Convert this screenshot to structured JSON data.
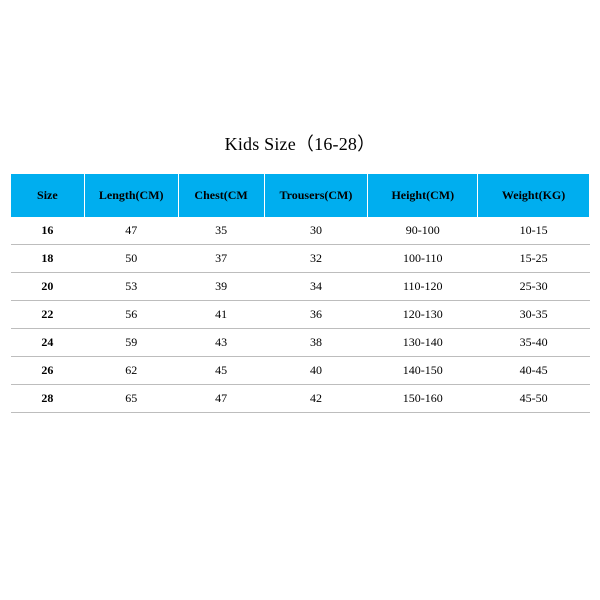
{
  "title": "Kids Size（16-28）",
  "columns": [
    "Size",
    "Length(CM)",
    "Chest(CM",
    "Trousers(CM)",
    "Height(CM)",
    "Weight(KG)"
  ],
  "rows": [
    {
      "size": "16",
      "length": "47",
      "chest": "35",
      "trousers": "30",
      "height": "90-100",
      "weight": "10-15"
    },
    {
      "size": "18",
      "length": "50",
      "chest": "37",
      "trousers": "32",
      "height": "100-110",
      "weight": "15-25"
    },
    {
      "size": "20",
      "length": "53",
      "chest": "39",
      "trousers": "34",
      "height": "110-120",
      "weight": "25-30"
    },
    {
      "size": "22",
      "length": "56",
      "chest": "41",
      "trousers": "36",
      "height": "120-130",
      "weight": "30-35"
    },
    {
      "size": "24",
      "length": "59",
      "chest": "43",
      "trousers": "38",
      "height": "130-140",
      "weight": "35-40"
    },
    {
      "size": "26",
      "length": "62",
      "chest": "45",
      "trousers": "40",
      "height": "140-150",
      "weight": "40-45"
    },
    {
      "size": "28",
      "length": "65",
      "chest": "47",
      "trousers": "42",
      "height": "150-160",
      "weight": "45-50"
    }
  ]
}
